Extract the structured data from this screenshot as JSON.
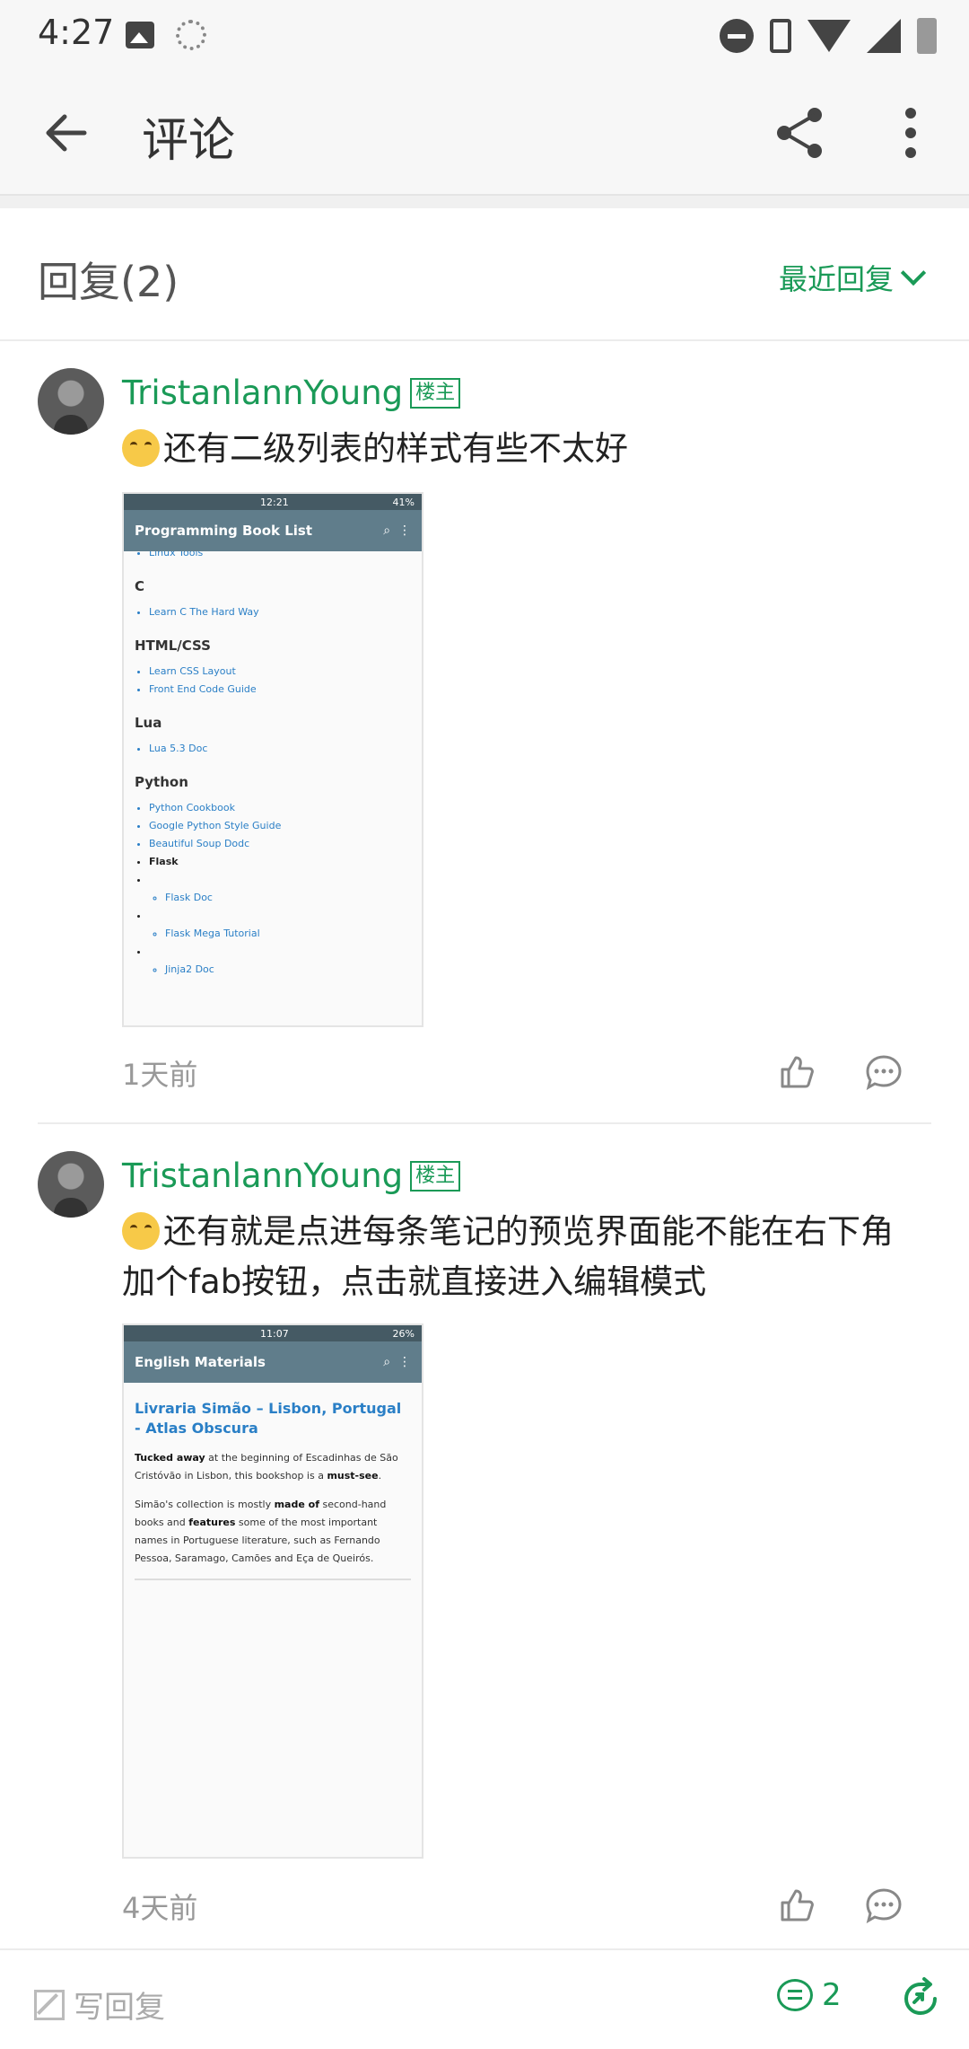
{
  "status_bar": {
    "time": "4:27"
  },
  "app_bar": {
    "title": "评论"
  },
  "reply_header": {
    "count_label": "回复(2)",
    "sort_label": "最近回复"
  },
  "comments": [
    {
      "author": "TristanlannYoung",
      "badge": "楼主",
      "text": "还有二级列表的样式有些不太好",
      "time": "1天前",
      "screenshot": {
        "status_time": "12:21",
        "status_battery": "41%",
        "title": "Programming Book List",
        "top_item": "Linux Tools",
        "sections": [
          {
            "heading": "C",
            "items": [
              "Learn C The Hard Way"
            ]
          },
          {
            "heading": "HTML/CSS",
            "items": [
              "Learn CSS Layout",
              "Front End Code Guide"
            ]
          },
          {
            "heading": "Lua",
            "items": [
              "Lua 5.3 Doc"
            ]
          },
          {
            "heading": "Python",
            "items": [
              "Python Cookbook",
              "Google Python Style Guide",
              "Beautiful Soup Dodc"
            ]
          }
        ],
        "flask": {
          "label": "Flask",
          "sub_items": [
            "Flask Doc",
            "Flask Mega Tutorial",
            "Jinja2 Doc"
          ]
        }
      }
    },
    {
      "author": "TristanlannYoung",
      "badge": "楼主",
      "text": "还有就是点进每条笔记的预览界面能不能在右下角加个fab按钮，点击就直接进入编辑模式",
      "time": "4天前",
      "screenshot": {
        "status_time": "11:07",
        "status_battery": "26%",
        "title": "English Materials",
        "article_title": "Livraria Simão – Lisbon, Portugal - Atlas Obscura",
        "p1_bold1": "Tucked away",
        "p1_text1": " at the beginning of Escadinhas de São Cristóvão in Lisbon, this bookshop is a ",
        "p1_bold2": "must-see",
        "p1_text2": ".",
        "p2_text1": "Simão's collection is mostly ",
        "p2_bold1": "made of",
        "p2_text2": " second-hand books and ",
        "p2_bold2": "features",
        "p2_text3": " some of the most important names in Portuguese literature, such as Fernando Pessoa, Saramago, Camões and Eça de Queirós."
      }
    }
  ],
  "bottom_bar": {
    "write_label": "写回复",
    "comment_count": "2"
  },
  "colors": {
    "accent": "#1a9a57",
    "toolbar": "#607d8b"
  },
  "icons": [
    "back-arrow-icon",
    "share-icon",
    "more-vert-icon",
    "chevron-down-icon",
    "thumb-up-icon",
    "comment-bubble-icon",
    "edit-icon",
    "forward-icon"
  ]
}
